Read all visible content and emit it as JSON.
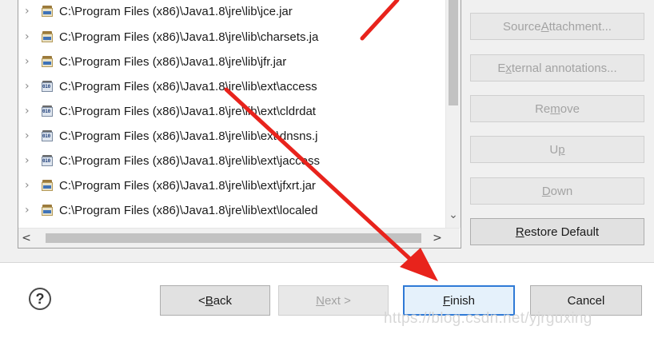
{
  "tree": {
    "rows": [
      {
        "label": "C:\\Program Files (x86)\\Java1.8\\jre\\lib\\jce.jar",
        "icon": "jar-icon"
      },
      {
        "label": "C:\\Program Files (x86)\\Java1.8\\jre\\lib\\charsets.ja",
        "icon": "jar-icon"
      },
      {
        "label": "C:\\Program Files (x86)\\Java1.8\\jre\\lib\\jfr.jar",
        "icon": "jar-icon"
      },
      {
        "label": "C:\\Program Files (x86)\\Java1.8\\jre\\lib\\ext\\access",
        "icon": "binary-jar-icon"
      },
      {
        "label": "C:\\Program Files (x86)\\Java1.8\\jre\\lib\\ext\\cldrdat",
        "icon": "binary-jar-icon"
      },
      {
        "label": "C:\\Program Files (x86)\\Java1.8\\jre\\lib\\ext\\dnsns.j",
        "icon": "binary-jar-icon"
      },
      {
        "label": "C:\\Program Files (x86)\\Java1.8\\jre\\lib\\ext\\jaccess",
        "icon": "binary-jar-icon"
      },
      {
        "label": "C:\\Program Files (x86)\\Java1.8\\jre\\lib\\ext\\jfxrt.jar",
        "icon": "jar-icon"
      },
      {
        "label": "C:\\Program Files (x86)\\Java1.8\\jre\\lib\\ext\\localed",
        "icon": "jar-icon"
      }
    ],
    "expand_glyph": "›"
  },
  "side_buttons": {
    "source_attachment": {
      "pre": "Source ",
      "mn": "A",
      "post": "ttachment..."
    },
    "external_annotations": {
      "pre": "E",
      "mn": "x",
      "post": "ternal annotations..."
    },
    "remove": {
      "pre": "Re",
      "mn": "m",
      "post": "ove"
    },
    "up": {
      "pre": "U",
      "mn": "p",
      "post": ""
    },
    "down": {
      "pre": "",
      "mn": "D",
      "post": "own"
    },
    "restore_default": {
      "pre": "",
      "mn": "R",
      "post": "estore Default"
    }
  },
  "footer": {
    "help": "?",
    "back": {
      "pre": "< ",
      "mn": "B",
      "post": "ack"
    },
    "next": {
      "pre": "",
      "mn": "N",
      "post": "ext >"
    },
    "finish": {
      "pre": "",
      "mn": "F",
      "post": "inish"
    },
    "cancel": "Cancel"
  },
  "scroll": {
    "left": "<",
    "right": ">",
    "down": "⌄"
  },
  "watermark": "https://blog.csdn.net/yjrguxing",
  "colors": {
    "annotation_arrow": "#e8231c",
    "default_button_border": "#2f7ad6"
  }
}
